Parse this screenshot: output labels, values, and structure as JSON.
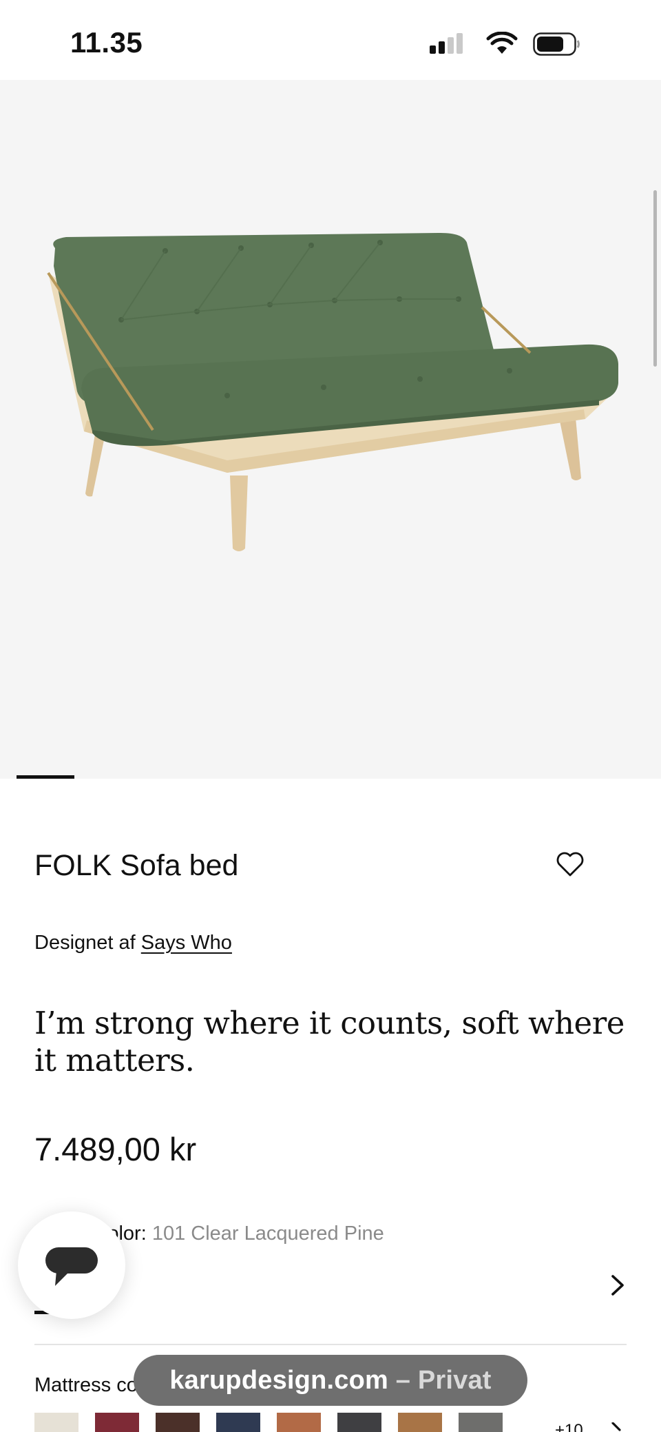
{
  "status_bar": {
    "time": "11.35",
    "signal_icon": "cellular-signal-icon",
    "wifi_icon": "wifi-icon",
    "battery_icon": "battery-icon"
  },
  "gallery": {
    "image": "sofa-bed-product-photo",
    "sofa_color": "#5d7857",
    "frame_wood_color": "#ead7b1",
    "background_color": "#f5f5f5"
  },
  "product": {
    "title": "FOLK Sofa bed",
    "designer_prefix": "Designet af",
    "designer_name": "Says Who",
    "tagline": "I’m strong where it counts, soft where it matters.",
    "price": "7.489,00 kr"
  },
  "frame_color": {
    "label": "Frame color:",
    "value": "101 Clear Lacquered Pine"
  },
  "mattress_color": {
    "label": "Mattress color",
    "swatches": [
      "#e6e1d6",
      "#7e2a36",
      "#4b3029",
      "#2f3a52",
      "#b26a46",
      "#3f3f42",
      "#a87446",
      "#6e6e6c"
    ],
    "more_count": "+10"
  },
  "chat_button": {
    "icon": "chat-bubble-icon"
  },
  "browser": {
    "domain": "karupdesign.com",
    "mode": "– Privat"
  }
}
